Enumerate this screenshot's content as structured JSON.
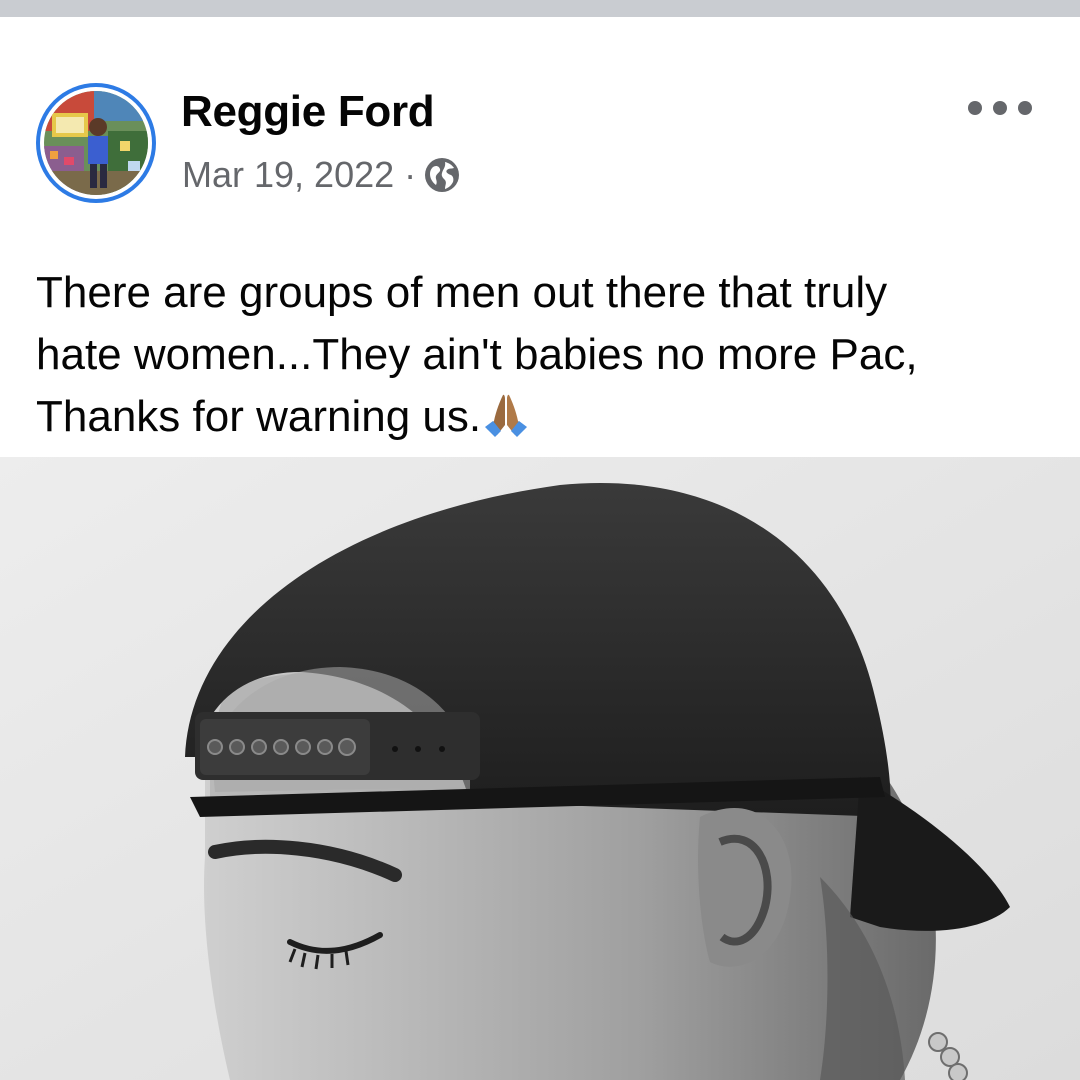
{
  "post": {
    "author": "Reggie Ford",
    "date": "Mar 19, 2022",
    "separator": "·",
    "privacy_icon": "globe-icon",
    "more_icon": "more-options-icon",
    "text_lines": [
      "There are groups of men out there that truly",
      "hate women...They ain't babies no more Pac,",
      "Thanks for warning us."
    ],
    "emoji": "folded-hands-emoji"
  },
  "colors": {
    "top_strip": "#c9ccd1",
    "name": "#050505",
    "meta": "#65676b",
    "avatar_ring": "#2d7be5",
    "photo_background": "#e5e5e5"
  }
}
